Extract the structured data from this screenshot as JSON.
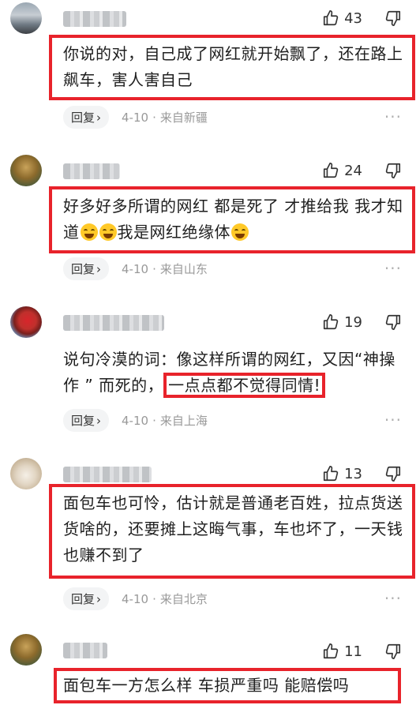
{
  "comments": [
    {
      "likes": "43",
      "text": "你说的对，自己成了网红就开始飘了，还在路上飙车，害人害自己",
      "reply_label": "回复",
      "date": "4-10",
      "location": "来自新疆"
    },
    {
      "likes": "24",
      "text_part1": "好多好多所谓的网红 都是死了 才推给我 我才知道",
      "text_part2": "我是网红绝缘体",
      "reply_label": "回复",
      "date": "4-10",
      "location": "来自山东"
    },
    {
      "likes": "19",
      "text_plain": "说句冷漠的词：像这样所谓的网红，又因“神操作 ” 而死的，",
      "text_highlight": "一点点都不觉得同情!",
      "reply_label": "回复",
      "date": "4-10",
      "location": "来自上海"
    },
    {
      "likes": "13",
      "text": "面包车也可怜，估计就是普通老百姓，拉点货送货啥的，还要摊上这晦气事，车也坏了，一天钱也赚不到了",
      "reply_label": "回复",
      "date": "4-10",
      "location": "来自北京"
    },
    {
      "likes": "11",
      "text": "面包车一方怎么样 车损严重吗 能赔偿吗"
    }
  ],
  "icons": {
    "like": "thumbs-up-icon",
    "dislike": "thumbs-down-icon",
    "chevron": "chevron-right-icon",
    "more": "more-dots-icon",
    "emoji": "laugh-cry-emoji-icon"
  },
  "colors": {
    "highlight": "#e8232b",
    "meta": "#999999",
    "reply_bg": "#f3f4f5"
  }
}
